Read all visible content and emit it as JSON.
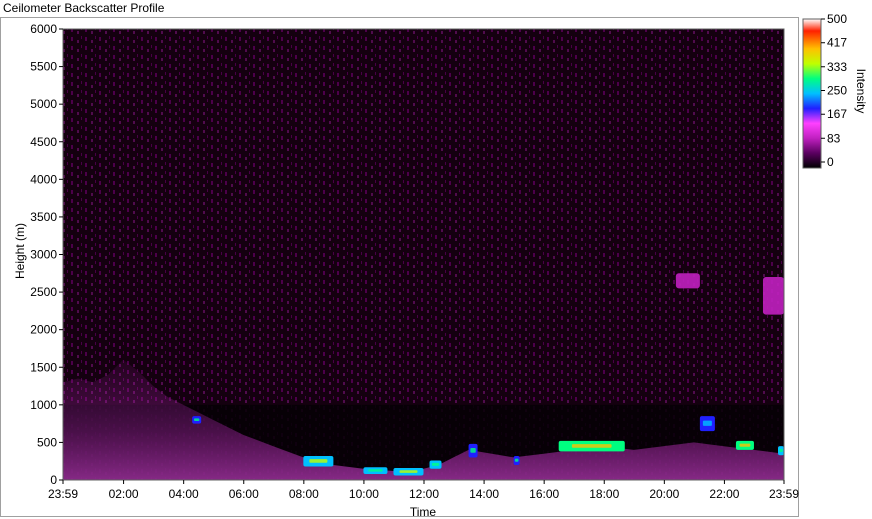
{
  "window": {
    "title": "Ceilometer Backscatter Profile"
  },
  "chart_data": {
    "type": "heatmap",
    "title": "Ceilometer Backscatter Profile",
    "xlabel": "Time",
    "ylabel": "Height (m)",
    "x_ticks": [
      "23:59",
      "02:00",
      "04:00",
      "06:00",
      "08:00",
      "10:00",
      "12:00",
      "14:00",
      "16:00",
      "18:00",
      "20:00",
      "22:00",
      "23:59"
    ],
    "x_tick_hours": [
      0,
      2.0167,
      4.0167,
      6.0167,
      8.0167,
      10.0167,
      12.0167,
      14.0167,
      16.0167,
      18.0167,
      20.0167,
      22.0167,
      24
    ],
    "xlim_hours": [
      0,
      24
    ],
    "y_ticks": [
      0,
      500,
      1000,
      1500,
      2000,
      2500,
      3000,
      3500,
      4000,
      4500,
      5000,
      5500,
      6000
    ],
    "ylim": [
      0,
      6000
    ],
    "colorbar": {
      "label": "Intensity",
      "ticks": [
        "500",
        "417",
        "333",
        "250",
        "167",
        "83",
        "0"
      ],
      "tick_values": [
        500,
        417,
        333,
        250,
        167,
        83,
        0
      ],
      "range": [
        0,
        500
      ],
      "colors": [
        "#000000",
        "#5a0060",
        "#c020c0",
        "#ff40ff",
        "#2020ff",
        "#00c0ff",
        "#00ff80",
        "#c0ff00",
        "#ffc000",
        "#ff2000",
        "#ffffff"
      ]
    },
    "background_color": "#14000f",
    "boundary_layer_top": [
      [
        0,
        1300
      ],
      [
        0.5,
        1350
      ],
      [
        1,
        1300
      ],
      [
        1.5,
        1400
      ],
      [
        2,
        1600
      ],
      [
        2.5,
        1450
      ],
      [
        3,
        1250
      ],
      [
        3.5,
        1100
      ],
      [
        4,
        1000
      ],
      [
        5,
        800
      ],
      [
        6,
        600
      ],
      [
        7,
        450
      ],
      [
        8,
        300
      ],
      [
        9,
        200
      ],
      [
        10,
        150
      ],
      [
        11,
        120
      ],
      [
        12,
        150
      ],
      [
        12.5,
        200
      ],
      [
        13,
        300
      ],
      [
        13.5,
        400
      ],
      [
        15,
        300
      ],
      [
        16,
        350
      ],
      [
        17,
        400
      ],
      [
        18,
        450
      ],
      [
        19,
        400
      ],
      [
        21,
        500
      ],
      [
        22,
        450
      ],
      [
        23,
        400
      ],
      [
        24,
        350
      ]
    ],
    "cloud_layers": [
      {
        "x": [
          4.3,
          4.6
        ],
        "y": [
          750,
          850
        ],
        "intensity": 200
      },
      {
        "x": [
          8.0,
          9.0
        ],
        "y": [
          180,
          320
        ],
        "intensity": 260
      },
      {
        "x": [
          10.0,
          10.8
        ],
        "y": [
          80,
          170
        ],
        "intensity": 240
      },
      {
        "x": [
          11.0,
          12.0
        ],
        "y": [
          60,
          160
        ],
        "intensity": 250
      },
      {
        "x": [
          12.2,
          12.6
        ],
        "y": [
          150,
          260
        ],
        "intensity": 230
      },
      {
        "x": [
          13.5,
          13.8
        ],
        "y": [
          300,
          480
        ],
        "intensity": 220
      },
      {
        "x": [
          15.0,
          15.2
        ],
        "y": [
          200,
          320
        ],
        "intensity": 200
      },
      {
        "x": [
          16.5,
          18.7
        ],
        "y": [
          380,
          520
        ],
        "intensity": 300
      },
      {
        "x": [
          21.2,
          21.7
        ],
        "y": [
          650,
          850
        ],
        "intensity": 180
      },
      {
        "x": [
          22.4,
          23.0
        ],
        "y": [
          400,
          520
        ],
        "intensity": 300
      },
      {
        "x": [
          23.8,
          24.0
        ],
        "y": [
          330,
          450
        ],
        "intensity": 230
      }
    ],
    "elevated_layers": [
      {
        "x": [
          20.4,
          21.2
        ],
        "y": [
          2550,
          2750
        ],
        "intensity": 120
      },
      {
        "x": [
          23.3,
          24.0
        ],
        "y": [
          2200,
          2700
        ],
        "intensity": 110
      }
    ],
    "legend": "colorbar-right",
    "grid": false
  }
}
